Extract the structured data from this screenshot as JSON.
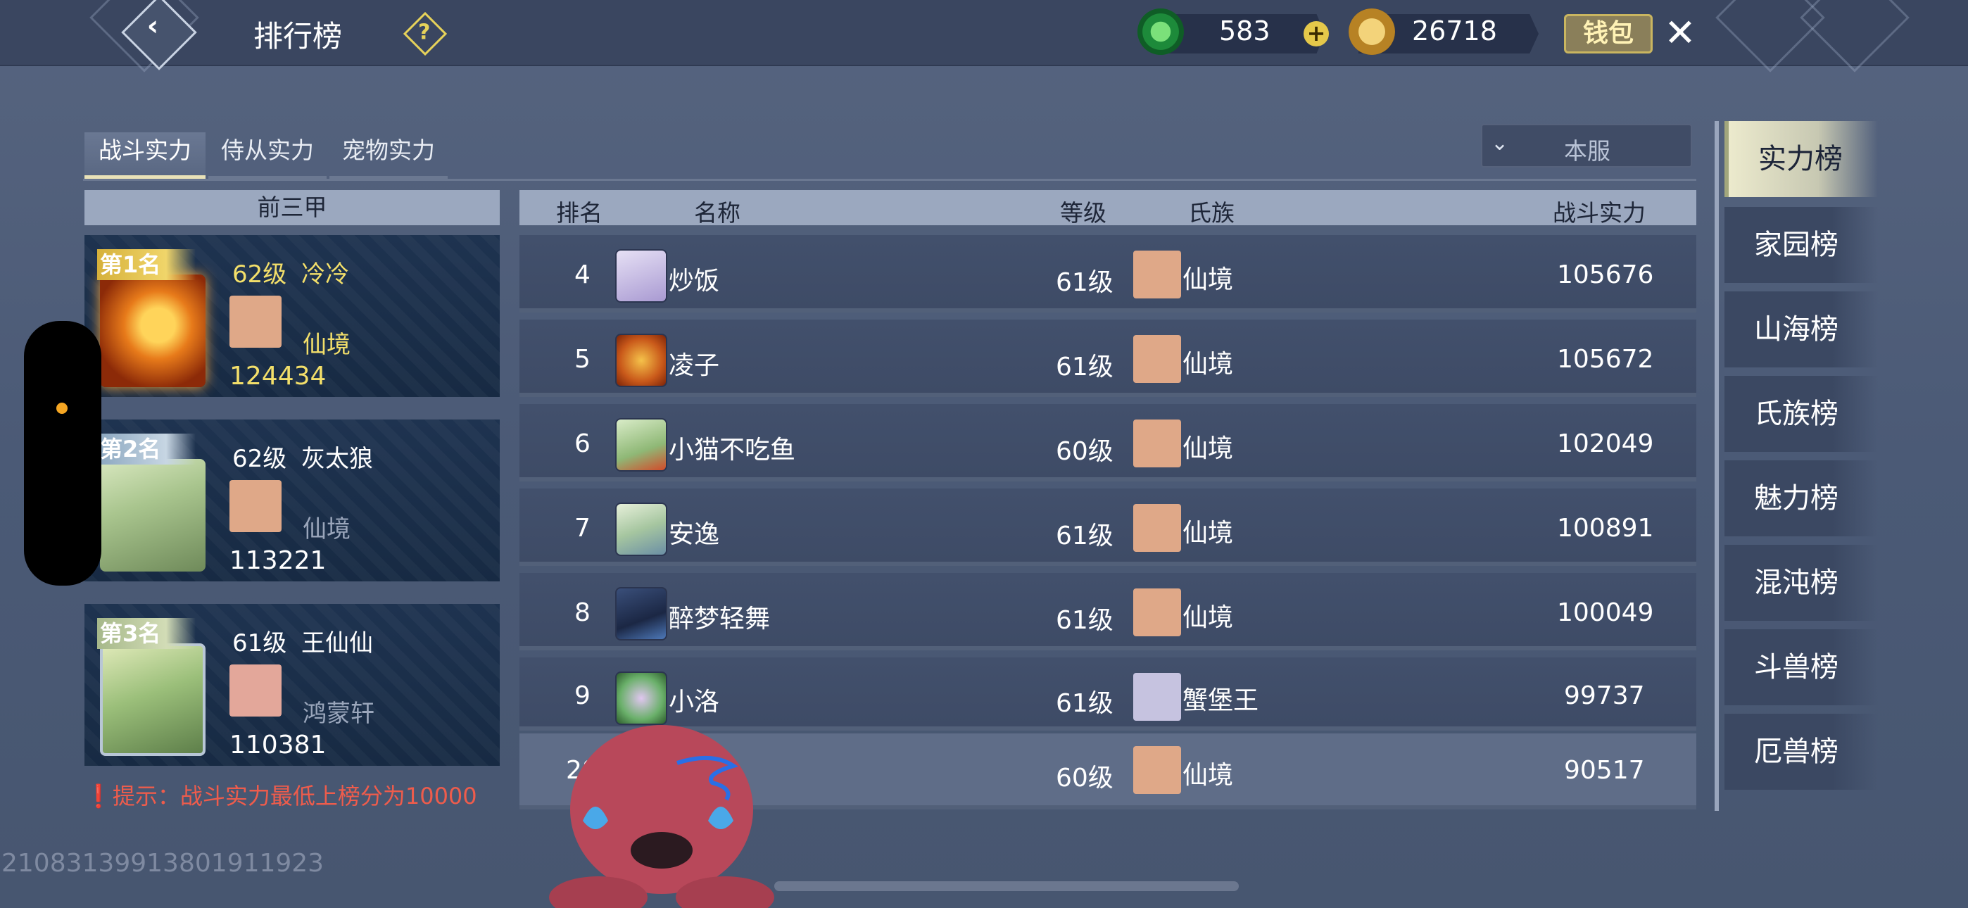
{
  "header": {
    "title": "排行榜",
    "jade": "583",
    "gold": "26718",
    "wallet_label": "钱包"
  },
  "tabs": [
    {
      "label": "战斗实力",
      "active": true
    },
    {
      "label": "侍从实力",
      "active": false
    },
    {
      "label": "宠物实力",
      "active": false
    }
  ],
  "server_select": {
    "value": "本服"
  },
  "top_three": {
    "header": "前三甲",
    "cards": [
      {
        "rank": "第1名",
        "level": "62级",
        "name": "冷冷",
        "clan": "仙境",
        "power": "124434"
      },
      {
        "rank": "第2名",
        "level": "62级",
        "name": "灰太狼",
        "clan": "仙境",
        "power": "113221"
      },
      {
        "rank": "第3名",
        "level": "61级",
        "name": "王仙仙",
        "clan": "鸿蒙轩",
        "power": "110381"
      }
    ]
  },
  "tip": "提示：战斗实力最低上榜分为10000",
  "table": {
    "columns": [
      "排名",
      "名称",
      "等级",
      "氏族",
      "战斗实力"
    ],
    "rows": [
      {
        "rank": "4",
        "name": "炒饭",
        "level": "61级",
        "clan": "仙境",
        "power": "105676"
      },
      {
        "rank": "5",
        "name": "凌子",
        "level": "61级",
        "clan": "仙境",
        "power": "105672"
      },
      {
        "rank": "6",
        "name": "小猫不吃鱼",
        "level": "60级",
        "clan": "仙境",
        "power": "102049"
      },
      {
        "rank": "7",
        "name": "安逸",
        "level": "61级",
        "clan": "仙境",
        "power": "100891"
      },
      {
        "rank": "8",
        "name": "醉梦轻舞",
        "level": "61级",
        "clan": "仙境",
        "power": "100049"
      },
      {
        "rank": "9",
        "name": "小洛",
        "level": "61级",
        "clan": "蟹堡王",
        "power": "99737"
      }
    ],
    "my_row": {
      "rank": "28",
      "name": "",
      "level": "60级",
      "clan": "仙境",
      "power": "90517"
    }
  },
  "side_nav": [
    {
      "label": "实力榜",
      "active": true
    },
    {
      "label": "家园榜"
    },
    {
      "label": "山海榜"
    },
    {
      "label": "氏族榜"
    },
    {
      "label": "魅力榜"
    },
    {
      "label": "混沌榜"
    },
    {
      "label": "斗兽榜"
    },
    {
      "label": "厄兽榜"
    }
  ],
  "uid": "21083139913801911923",
  "colors": {
    "accent_gold": "#f3df6a",
    "tip_red": "#ee5c4c",
    "clan_icon": "#dfa888"
  }
}
